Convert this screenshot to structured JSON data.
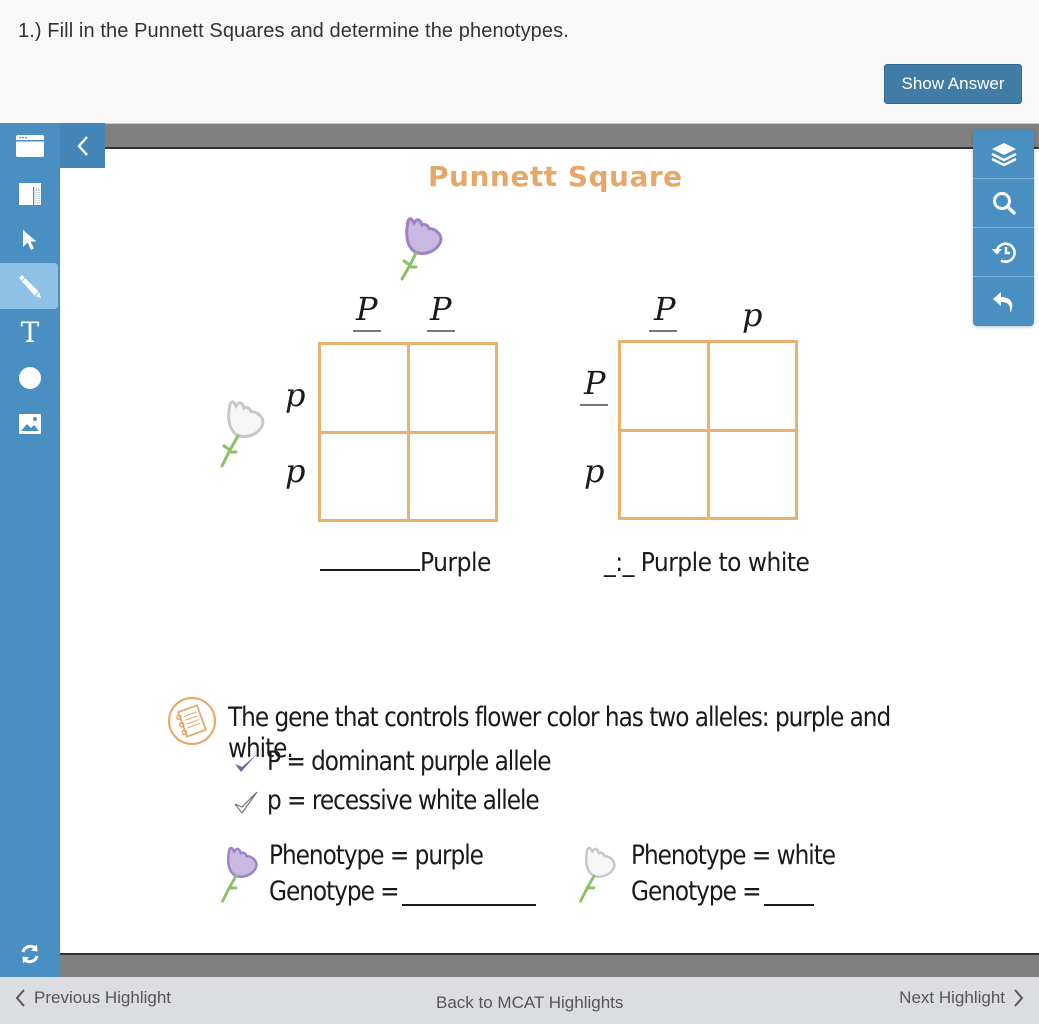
{
  "header": {
    "question": "1.)  Fill in the Punnett Squares and determine the phenotypes.",
    "show_answer_label": "Show Answer"
  },
  "left_toolbar": {
    "items": [
      {
        "name": "window-icon",
        "label": "Window"
      },
      {
        "name": "panel-icon",
        "label": "Panel"
      },
      {
        "name": "pointer-icon",
        "label": "Select"
      },
      {
        "name": "pencil-icon",
        "label": "Draw",
        "active": true
      },
      {
        "name": "text-icon",
        "label": "Text",
        "glyph": "T"
      },
      {
        "name": "circle-icon",
        "label": "Shape"
      },
      {
        "name": "image-icon",
        "label": "Image"
      },
      {
        "name": "refresh-icon",
        "label": "Reset"
      }
    ],
    "collapse_icon": "chevron-left-icon"
  },
  "right_toolbar": {
    "items": [
      {
        "name": "layers-icon"
      },
      {
        "name": "search-icon"
      },
      {
        "name": "history-icon"
      },
      {
        "name": "undo-icon"
      }
    ]
  },
  "content": {
    "title": "Punnett Square",
    "square1": {
      "top_alleles": [
        "P",
        "P"
      ],
      "top_underlined": [
        true,
        true
      ],
      "side_alleles": [
        "p",
        "p"
      ],
      "side_underlined": [
        false,
        false
      ],
      "cells": [
        "",
        "",
        "",
        ""
      ],
      "caption_blank": "",
      "caption": "Purple"
    },
    "square2": {
      "top_alleles": [
        "P",
        "p"
      ],
      "top_underlined": [
        true,
        false
      ],
      "side_alleles": [
        "P",
        "p"
      ],
      "side_underlined": [
        true,
        false
      ],
      "cells": [
        "",
        "",
        "",
        ""
      ],
      "caption_ratio": "_:_",
      "caption": "Purple to white"
    },
    "info": {
      "heading": "The gene that controls flower color has two alleles: purple and white.",
      "dominant": "P = dominant purple allele",
      "recessive": "p = recessive white allele",
      "purple_phenotype": "Phenotype = purple",
      "purple_genotype": "Genotype =",
      "white_phenotype": "Phenotype = white",
      "white_genotype": "Genotype ="
    },
    "colors": {
      "purple_flower": "#c9b8e0",
      "purple_outline": "#9d82c6",
      "white_flower": "#f4f4f4",
      "white_outline": "#c8c8cc",
      "stem": "#8cc168",
      "grid": "#e8b170",
      "title": "#e6a868",
      "check_purple": "#7c5db5"
    }
  },
  "footer": {
    "previous": "Previous Highlight",
    "back": "Back to MCAT Highlights",
    "next": "Next Highlight"
  }
}
